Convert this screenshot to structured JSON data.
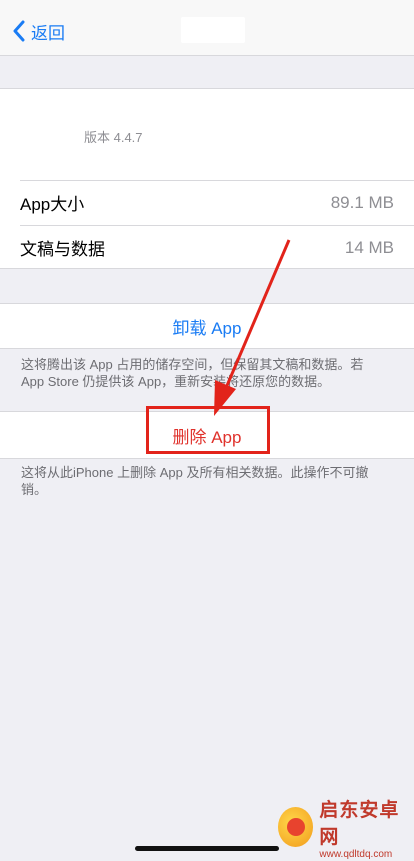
{
  "navbar": {
    "back_label": "返回"
  },
  "info": {
    "version": "版本 4.4.7",
    "rows": [
      {
        "label": "App大小",
        "value": "89.1 MB"
      },
      {
        "label": "文稿与数据",
        "value": "14 MB"
      }
    ]
  },
  "actions": {
    "offload_label": "卸载 App",
    "offload_note": "这将腾出该 App 占用的储存空间，但保留其文稿和数据。若 App Store 仍提供该 App，重新安装将还原您的数据。",
    "delete_label": "删除 App",
    "delete_note": "这将从此iPhone 上删除 App 及所有相关数据。此操作不可撤销。"
  },
  "colors": {
    "link_blue": "#1a7cf4",
    "destructive_red": "#e0322c",
    "annotation_red": "#e2231a"
  },
  "watermark": {
    "name": "启东安卓网",
    "url": "www.qdltdq.com"
  }
}
